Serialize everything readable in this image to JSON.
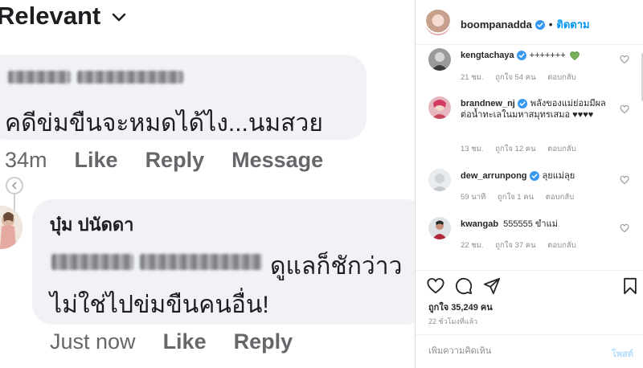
{
  "facebook": {
    "sort_label": "Relevant",
    "comment1": {
      "text": "คดีข่มขืนจะหมดได้ไง...นมสวย",
      "time": "34m",
      "like_label": "Like",
      "reply_label": "Reply",
      "message_label": "Message"
    },
    "comment2": {
      "author": "บุ๋ม ปนัดดา",
      "line1": "ดูแลก็ชักว่าว",
      "line2": "ไม่ใช่ไปข่มขืนคนอื่น!",
      "time": "Just now",
      "like_label": "Like",
      "reply_label": "Reply"
    }
  },
  "instagram": {
    "header": {
      "username": "boompanadda",
      "separator": "•",
      "follow_label": "ติดตาม"
    },
    "comments": [
      {
        "username": "kengtachaya",
        "verified": true,
        "text": "+++++++",
        "emoji": "green-heart",
        "age": "21 ชม.",
        "likes": "ถูกใจ 54 คน",
        "reply": "ตอบกลับ"
      },
      {
        "username": "brandnew_nj",
        "verified": true,
        "text": "พลังของแม่ย่อมมีผลต่อน้ำทะเลในมหาสมุทรเสมอ ♥♥♥♥",
        "age": "13 ชม.",
        "likes": "ถูกใจ 12 คน",
        "reply": "ตอบกลับ"
      },
      {
        "username": "dew_arrunpong",
        "verified": true,
        "text": "ลุยแม่ลุย",
        "age": "59 นาที",
        "likes": "ถูกใจ 1 คน",
        "reply": "ตอบกลับ"
      },
      {
        "username": "kwangab",
        "verified": false,
        "text": "555555 ขำแม่",
        "age": "22 ชม.",
        "likes": "ถูกใจ 37 คน",
        "reply": "ตอบกลับ"
      }
    ],
    "likes_count": "ถูกใจ 35,249 คน",
    "posted_time": "22 ชั่วโมงที่แล้ว",
    "add_comment_placeholder": "เพิ่มความคิดเห็น",
    "post_label": "โพสต์",
    "colors": {
      "link_blue": "#0095f6",
      "verified_blue": "#3897f0",
      "muted": "#8e8e8e"
    }
  }
}
